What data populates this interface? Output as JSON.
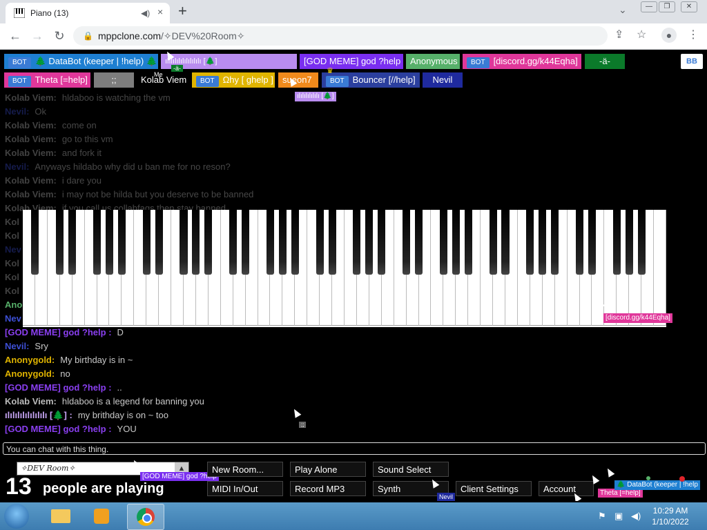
{
  "browser": {
    "tab_title": "Piano (13)",
    "tab_audio_icon": "speaker-icon",
    "tab_close": "×",
    "new_tab": "+",
    "tab_search": "⌄",
    "url_host": "mppclone.com",
    "url_path": "/✧DEV%20Room✧",
    "win_min": "—",
    "win_max": "❐",
    "win_close": "✕"
  },
  "players_row1": [
    {
      "bot": true,
      "label": "🌲 DataBot (keeper | !help) 🌲",
      "color": "#1e7fd1"
    },
    {
      "bot": false,
      "label": "ılılılılılılılılılı [🌲]",
      "color": "#b98cf0"
    },
    {
      "bot": false,
      "label": "[GOD MEME] god ?help",
      "color": "#7a2ff0"
    },
    {
      "bot": false,
      "label": "Anonymous",
      "color": "#57b06a"
    },
    {
      "bot": true,
      "label": "[discord.gg/k44Eqha]",
      "color": "#e0379a"
    },
    {
      "bot": false,
      "label": "-ä-",
      "color": "#0b7a2a"
    }
  ],
  "players_row2": [
    {
      "bot": true,
      "label": "Theta [=help]",
      "color": "#e0379a"
    },
    {
      "bot": false,
      "label": ";;",
      "color": "#7d7d7d"
    },
    {
      "bot": false,
      "label": "Kolab Viem",
      "color": "#000000"
    },
    {
      "bot": true,
      "label": "Ωhy [ ghelp ]",
      "color": "#e0b400"
    },
    {
      "bot": false,
      "label": "sueon7",
      "color": "#f08a1c"
    },
    {
      "bot": true,
      "label": "Bouncer [//help]",
      "color": "#2b3f9e"
    },
    {
      "bot": false,
      "label": "Nevil",
      "color": "#1f2a9e"
    }
  ],
  "top_right_button": "BB",
  "floating_labels": {
    "me": "Me",
    "green_tag": "-ä-",
    "purple_tag": "ılılılılılılı [🌲]",
    "pink_tag": "[discord.gg/k44Eqha]",
    "room_cursor_tag": "[GOD MEME] god ?help",
    "nevil_tag": "Nevil",
    "theta_tag": "Theta [=help]",
    "databot_tag": "🌲 DataBot (keeper | !help"
  },
  "chat": [
    {
      "name": "Kolab Viem:",
      "text": "hldaboo is watching the vm",
      "color": "#bbbbbb",
      "dim": true
    },
    {
      "name": "Nevil:",
      "text": "Ok",
      "color": "#3d4fd6",
      "dim": true
    },
    {
      "name": "Kolab Viem:",
      "text": "come on",
      "color": "#bbbbbb",
      "dim": true
    },
    {
      "name": "Kolab Viem:",
      "text": "go to this vm",
      "color": "#bbbbbb",
      "dim": true
    },
    {
      "name": "Kolab Viem:",
      "text": "and fork it",
      "color": "#bbbbbb",
      "dim": true
    },
    {
      "name": "Nevil:",
      "text": "Anyways hildabo why did u ban me for no reson?",
      "color": "#3d4fd6",
      "dim": true
    },
    {
      "name": "Kolab Viem:",
      "text": "i dare you",
      "color": "#bbbbbb",
      "dim": true
    },
    {
      "name": "Kolab Viem:",
      "text": "i may not be hilda but you deserve to be banned",
      "color": "#bbbbbb",
      "dim": true
    },
    {
      "name": "Kolab Viem:",
      "text": "if you call us collabfags then stay banned",
      "color": "#bbbbbb",
      "dim": true
    },
    {
      "name": "Kol",
      "text": "",
      "color": "#bbbbbb",
      "dim": true
    },
    {
      "name": "Kol",
      "text": "",
      "color": "#bbbbbb",
      "dim": true
    },
    {
      "name": "Nev",
      "text": "",
      "color": "#3d4fd6",
      "dim": true
    },
    {
      "name": "Kol",
      "text": "",
      "color": "#bbbbbb",
      "dim": true
    },
    {
      "name": "Kol",
      "text": "",
      "color": "#bbbbbb",
      "dim": true
    },
    {
      "name": "Kol",
      "text": "",
      "color": "#bbbbbb",
      "dim": true
    },
    {
      "name": "Ano",
      "text": "",
      "color": "#57b06a",
      "dim": false
    },
    {
      "name": "Nev",
      "text": "",
      "color": "#3d4fd6",
      "dim": false
    },
    {
      "name": "[GOD MEME] god ?help :",
      "text": "D",
      "color": "#8a3ff0",
      "dim": false
    },
    {
      "name": "Nevil:",
      "text": "Sry",
      "color": "#3d4fd6",
      "dim": false
    },
    {
      "name": "Anonygold:",
      "text": "My birthday is in ~",
      "color": "#e0b400",
      "dim": false
    },
    {
      "name": "Anonygold:",
      "text": "no",
      "color": "#e0b400",
      "dim": false
    },
    {
      "name": "[GOD MEME] god ?help :",
      "text": "..",
      "color": "#8a3ff0",
      "dim": false
    },
    {
      "name": "Kolab Viem:",
      "text": "hldaboo is a legend for banning you",
      "color": "#bbbbbb",
      "dim": false
    },
    {
      "name": "ılılılılılılılılı [🌲] :",
      "text": "my brithday is on ~ too",
      "color": "#c7a5f5",
      "dim": false
    },
    {
      "name": "[GOD MEME] god ?help :",
      "text": "YOU",
      "color": "#8a3ff0",
      "dim": false
    }
  ],
  "chat_input_placeholder": "You can chat with this thing.",
  "room": {
    "name": "✧DEV Room✧",
    "arrow": "▲"
  },
  "players_count": "13",
  "players_label": "people are playing",
  "buttons": {
    "new_room": "New Room...",
    "play_alone": "Play Alone",
    "sound_select": "Sound Select",
    "midi": "MIDI In/Out",
    "record": "Record MP3",
    "synth": "Synth",
    "client_settings": "Client Settings",
    "account": "Account"
  },
  "taskbar": {
    "time": "10:29 AM",
    "date": "1/10/2022"
  }
}
